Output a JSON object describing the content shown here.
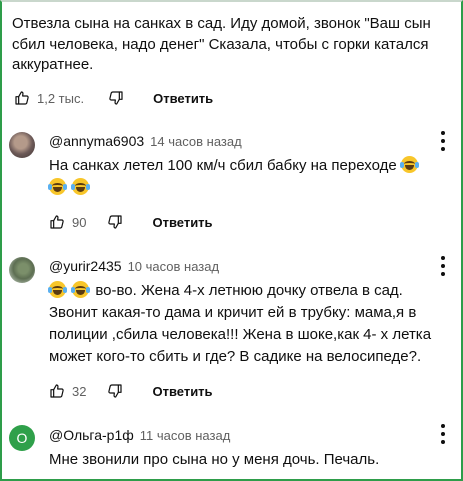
{
  "post": {
    "text": "Отвезла сына на санках в сад. Иду домой, звонок \"Ваш сын сбил человека, надо денег\" Сказала, чтобы с горки катался аккуратнее.",
    "likes": "1,2 тыс.",
    "reply_label": "Ответить"
  },
  "comments": [
    {
      "avatar_letter": "",
      "handle": "@annyma6903",
      "time": "14 часов назад",
      "text_before": "На санках летел 100 км/ч сбил бабку на переходе",
      "likes": "90",
      "reply_label": "Ответить"
    },
    {
      "avatar_letter": "",
      "handle": "@yurir2435",
      "time": "10 часов назад",
      "text_after": "во-во. Жена 4-х летнюю дочку отвела в сад. Звонит какая-то дама и кричит ей в трубку: мама,я в полиции ,сбила человека!!! Жена в шоке,как 4- х летка может кого-то сбить и где? В садике на велосипеде?.",
      "likes": "32",
      "reply_label": "Ответить"
    },
    {
      "avatar_letter": "О",
      "handle": "@Ольга-р1ф",
      "time": "11 часов назад",
      "text": "Мне звонили про сына но у меня дочь. Печаль."
    }
  ],
  "icons": {
    "like": "thumbs-up-icon",
    "dislike": "thumbs-down-icon",
    "menu": "more-vert-icon",
    "emoji": "face-with-tears-of-joy"
  },
  "colors": {
    "frame_border": "#2e9d4a",
    "avatar_o": "#2fa04a",
    "meta_text": "#606060",
    "emoji": "#f8c62a"
  }
}
